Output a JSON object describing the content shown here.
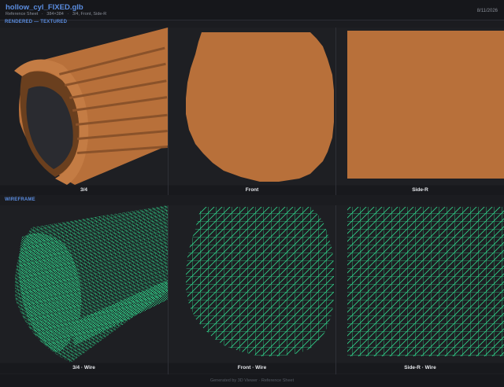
{
  "header": {
    "title": "hollow_cyl_FIXED.glb",
    "subtitle": "Reference Sheet   ·   384×384   ·   3/4, Front, Side-R",
    "date": "8/11/2026"
  },
  "sections": {
    "rendered": "RENDERED — TEXTURED",
    "wireframe": "WIREFRAME"
  },
  "panels": {
    "top": [
      "3/4",
      "Front",
      "Side-R"
    ],
    "bottom": [
      "3/4  ·  Wire",
      "Front  ·  Wire",
      "Side-R  ·  Wire"
    ]
  },
  "colors": {
    "texture": "#b8703a",
    "texture_dark": "#8a522a",
    "wire": "#2fd38a",
    "bg": "#1e1f23"
  },
  "footer": "Generated by 3D Viewer · Reference Sheet"
}
